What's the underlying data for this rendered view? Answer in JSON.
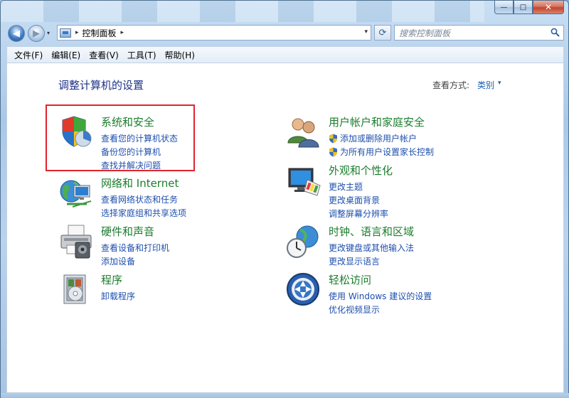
{
  "window": {
    "caption": {
      "minimize": "—",
      "maximize": "□",
      "close": "✕"
    }
  },
  "nav": {
    "back_glyph": "◀",
    "forward_glyph": "▶",
    "dropdown_glyph": "▾",
    "address": {
      "separator": "▸",
      "path": "控制面板",
      "end_separator": "▸",
      "dropdown_glyph": "▾"
    },
    "refresh_glyph": "⟳",
    "search": {
      "placeholder": "搜索控制面板",
      "icon": "search-icon"
    }
  },
  "menubar": {
    "items": [
      "文件(F)",
      "编辑(E)",
      "查看(V)",
      "工具(T)",
      "帮助(H)"
    ]
  },
  "content": {
    "title": "调整计算机的设置",
    "view_by_label": "查看方式:",
    "view_by_value": "类别",
    "view_by_arrow": "▾",
    "categories": [
      {
        "title": "系统和安全",
        "icon": "shield-icon",
        "links": [
          "查看您的计算机状态",
          "备份您的计算机",
          "查找并解决问题"
        ]
      },
      {
        "title": "网络和 Internet",
        "icon": "network-globe-icon",
        "links": [
          "查看网络状态和任务",
          "选择家庭组和共享选项"
        ]
      },
      {
        "title": "硬件和声音",
        "icon": "printer-icon",
        "links": [
          "查看设备和打印机",
          "添加设备"
        ]
      },
      {
        "title": "程序",
        "icon": "programs-icon",
        "links": [
          "卸载程序"
        ]
      },
      {
        "title": "用户帐户和家庭安全",
        "icon": "users-icon",
        "links": [
          "添加或删除用户帐户",
          "为所有用户设置家长控制"
        ],
        "link_icons": [
          "uac-shield-icon",
          "uac-shield-icon"
        ]
      },
      {
        "title": "外观和个性化",
        "icon": "monitor-palette-icon",
        "links": [
          "更改主题",
          "更改桌面背景",
          "调整屏幕分辨率"
        ]
      },
      {
        "title": "时钟、语言和区域",
        "icon": "clock-globe-icon",
        "links": [
          "更改键盘或其他输入法",
          "更改显示语言"
        ]
      },
      {
        "title": "轻松访问",
        "icon": "ease-of-access-icon",
        "links": [
          "使用 Windows 建议的设置",
          "优化视频显示"
        ]
      }
    ]
  }
}
